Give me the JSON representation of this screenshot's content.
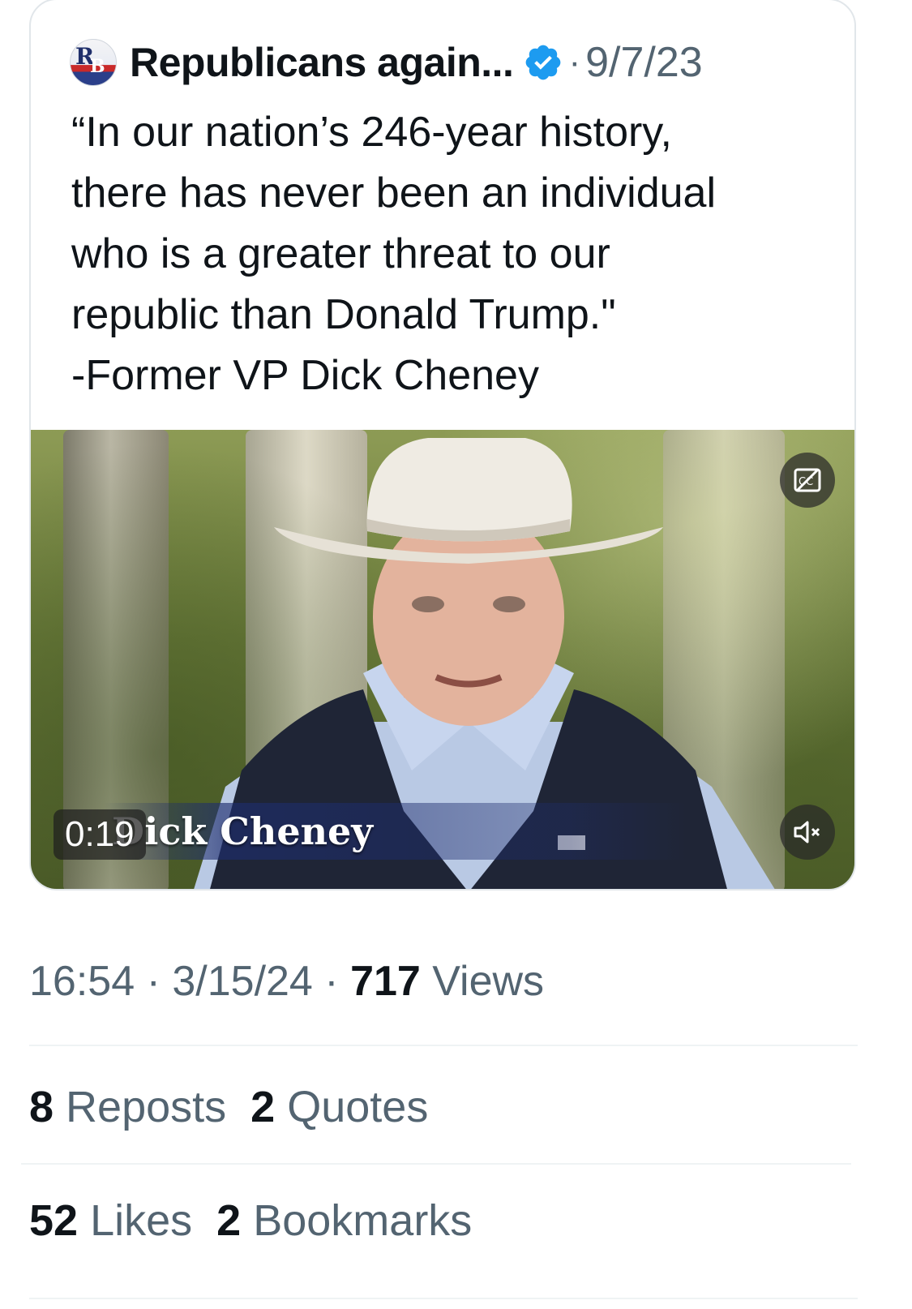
{
  "quoted_tweet": {
    "avatar_alt": "RB",
    "author_name": "Republicans again...",
    "separator": "·",
    "date": "9/7/23",
    "text": "“In our nation’s 246-year history,\nthere has never been an individual\nwho is a greater threat to our\nrepublic than Donald Trump.\"\n-Former VP Dick Cheney",
    "video": {
      "lower_third_name": "Dick Cheney",
      "duration": "0:19",
      "cc_icon": "captions-icon",
      "mute_icon": "muted-speaker-icon"
    }
  },
  "tweet_meta": {
    "time": "16:54",
    "sep1": " · ",
    "date": "3/15/24",
    "sep2": " · ",
    "views_count": "717",
    "views_label": " Views"
  },
  "engagement": {
    "reposts_count": "8",
    "reposts_label": " Reposts",
    "quotes_count": "2",
    "quotes_label": " Quotes",
    "likes_count": "52",
    "likes_label": " Likes",
    "bookmarks_count": "2",
    "bookmarks_label": " Bookmarks"
  },
  "colors": {
    "text_primary": "#0f1419",
    "text_secondary": "#536471",
    "verified_blue": "#1d9bf0",
    "border": "#e1e6ea"
  }
}
